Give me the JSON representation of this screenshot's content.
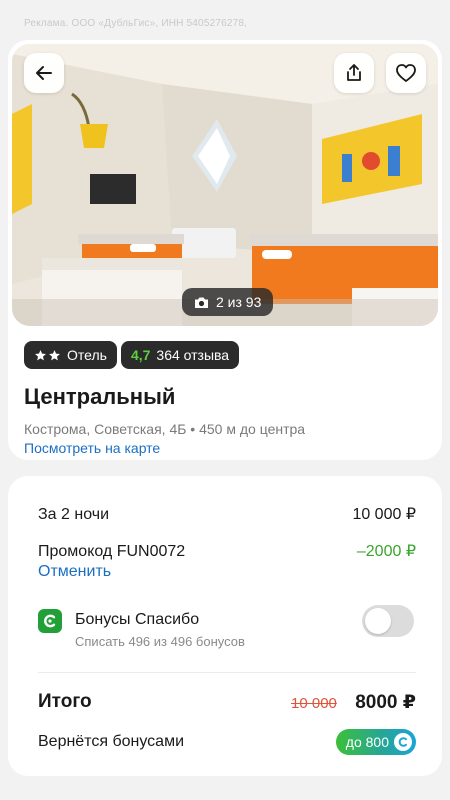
{
  "ad_notice": "Реклама. ООО «ДубльГис», ИНН 5405276278,",
  "hotel": {
    "photo_counter": "2 из 93",
    "category_label": "Отель",
    "stars_count": 2,
    "rating": "4,7",
    "reviews": "364 отзыва",
    "name": "Центральный",
    "address": "Кострома, Советская, 4Б • 450 м до центра",
    "map_link": "Посмотреть на карте"
  },
  "icons": [
    "arrow-left-icon",
    "share-icon",
    "heart-icon",
    "camera-icon",
    "star-icon",
    "spasibo-logo-icon"
  ],
  "pricing": {
    "nights_label": "За 2 ночи",
    "nights_price": "10 000 ₽",
    "promo_label": "Промокод FUN0072",
    "promo_discount": "–2000 ₽",
    "cancel_label": "Отменить",
    "bonus_title": "Бонусы Спасибо",
    "bonus_subtitle": "Списать 496 из 496 бонусов",
    "bonus_toggle_on": false,
    "total_label": "Итого",
    "old_price": "10 000",
    "total_price": "8000 ₽",
    "cashback_label": "Вернётся бонусами",
    "cashback_value": "до 800"
  },
  "colors": {
    "accent_link": "#1b6fc2",
    "rating_green": "#5bd13c",
    "discount_green": "#3aa52c",
    "old_price_red": "#e0533d",
    "spasibo_green": "#21a038"
  }
}
